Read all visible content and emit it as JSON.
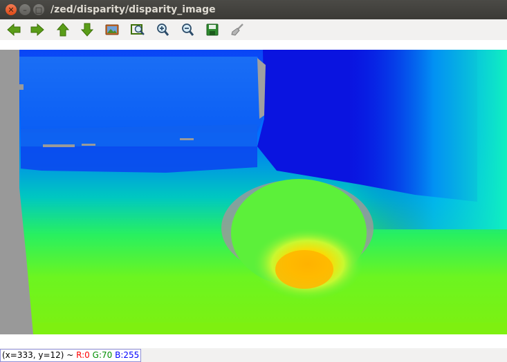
{
  "window": {
    "title": "/zed/disparity/disparity_image"
  },
  "toolbar": {
    "buttons": [
      {
        "icon": "back-arrow-icon"
      },
      {
        "icon": "forward-arrow-icon"
      },
      {
        "icon": "up-arrow-icon"
      },
      {
        "icon": "down-arrow-icon"
      },
      {
        "icon": "image-icon"
      },
      {
        "icon": "zoom-fit-icon"
      },
      {
        "icon": "zoom-in-icon"
      },
      {
        "icon": "zoom-out-icon"
      },
      {
        "icon": "save-icon"
      },
      {
        "icon": "clear-brush-icon"
      }
    ]
  },
  "status": {
    "coords": "(x=333, y=12) ~ ",
    "r": "R:0",
    "g": "G:70",
    "b": "B:255"
  },
  "colors": {
    "arrow_green": "#4e9a06",
    "title_bar": "#3c3b37",
    "close_button": "#e95420"
  }
}
